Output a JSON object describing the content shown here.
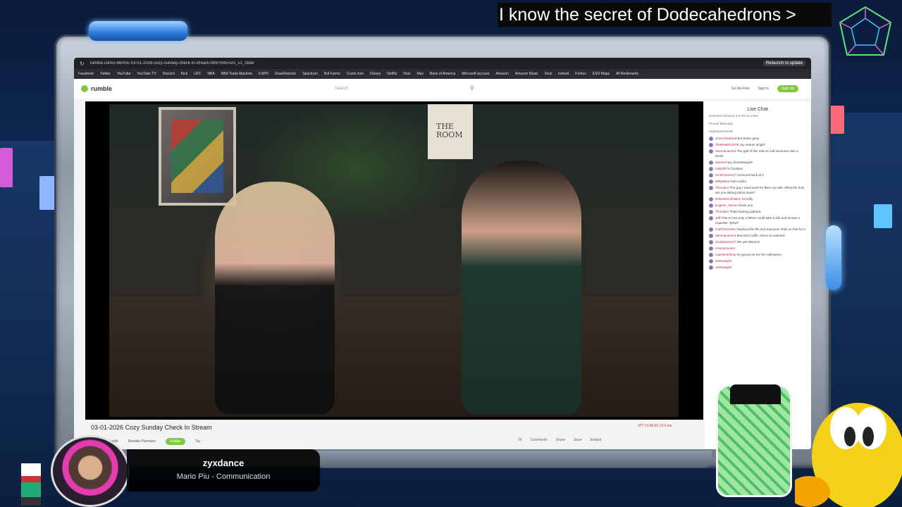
{
  "banner": {
    "text": "I know the secret of Dodecahedrons >"
  },
  "browser": {
    "url": "rumble.com/v-66m0c-03-01-2026-cozy-sunday-check-in-stream.html?e9s=src_v1_cbl&r",
    "relaunch_label": "Relaunch to update",
    "bookmarks": [
      "Facebook",
      "Twitter",
      "YouTube",
      "YouTube TV",
      "Discord",
      "Kick",
      "UFC",
      "NBA",
      "NBA Trade Machine",
      "ESPN",
      "DrawDetector",
      "Spectrum",
      "Bot Farms",
      "Crank Icon",
      "Disney",
      "Netflix",
      "Hulu",
      "Max",
      "Bank of America",
      "Microsoft account",
      "Amazon",
      "Amazon Music",
      "Deal",
      "Indeed",
      "Forbes",
      "ESO Maps",
      "All Bookmarks"
    ]
  },
  "rumble": {
    "logo": "rumble",
    "search_placeholder": "Search",
    "go_ad_free": "Go Ad-Free",
    "sign_in": "Sign In",
    "sign_up": "Sign Up",
    "video_title": "03-01-2026 Cozy Sunday Check In Stream",
    "channel": "Nightwave Noelle",
    "premium": "Rumble Premium",
    "follow": "Follow",
    "tip": "Tip",
    "stats": "377  |  0:36:25  |  0.0 ms",
    "actions": [
      "29",
      "Comments",
      "Share",
      "Save",
      "Embed"
    ],
    "room_sign": "THE ROOM"
  },
  "chat": {
    "title": "Live Chat",
    "pinned": [
      "DrDexterChristine 0.0 PS Its critter",
      "Pinned Message",
      "NightwaveNoelle"
    ],
    "messages": [
      {
        "user": "Jimm Rowland",
        "text": "Bot broke gimp"
      },
      {
        "user": "TheRealPoohTK",
        "text": "ray seems alright"
      },
      {
        "user": "StevesLament",
        "text": "The gall of this man to call someone else a drunk"
      },
      {
        "user": "dymm3",
        "text": "hey @Jessweg28"
      },
      {
        "user": "hollyhill",
        "text": "hi Christian"
      },
      {
        "user": "ScottGamer17",
        "text": "Ammond back at it"
      },
      {
        "user": "WillyMars",
        "text": "Gym sucks"
      },
      {
        "user": "Thompsn",
        "text": "The guy I used work for likes my wife. What the fuck are you talking about dude?"
      },
      {
        "user": "DrDexterChristine",
        "text": "Hi Kelly"
      },
      {
        "user": "Eugene_Stoner",
        "text": "thank you"
      },
      {
        "user": "Thompsn",
        "text": "Thats fucking pathetic"
      },
      {
        "user": "Jaff",
        "text": "This is how only a father could take a shit and smoke a cigarette. What?"
      },
      {
        "user": "CarlTheGreen",
        "text": "Rayfuss this fits and everyone shits on him for it"
      },
      {
        "user": "StevesLament",
        "text": "Morchid Crafts, Gemo is retarded"
      },
      {
        "user": "ScottGamer17",
        "text": "We got Wamen!"
      },
      {
        "user": "Anonymouser",
        "text": ""
      },
      {
        "user": "coachieshrimp",
        "text": "Im gonna be her for Halloween"
      },
      {
        "user": "Jessweg28",
        "text": ""
      },
      {
        "user": "Jessweg28",
        "text": ""
      }
    ]
  },
  "now_playing": {
    "user": "zyxdance",
    "track": "Mario Piu - Communication"
  }
}
